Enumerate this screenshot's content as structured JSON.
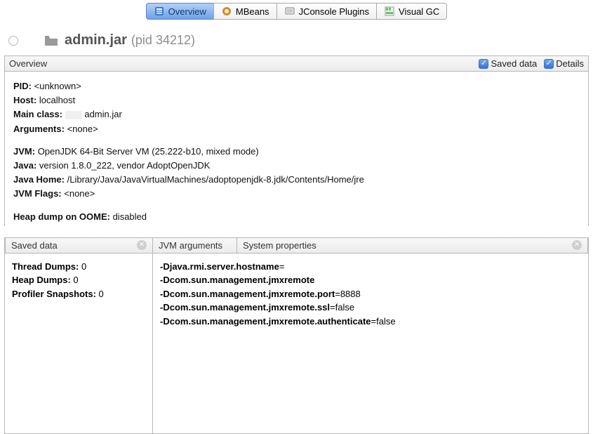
{
  "tabs": [
    {
      "label": "Overview",
      "icon": "overview"
    },
    {
      "label": "MBeans",
      "icon": "mbeans"
    },
    {
      "label": "JConsole Plugins",
      "icon": "jconsole"
    },
    {
      "label": "Visual GC",
      "icon": "visualgc"
    }
  ],
  "header": {
    "title": "admin.jar",
    "pid_label": "(pid 34212)"
  },
  "overview_bar": {
    "title": "Overview",
    "saved_data_label": "Saved data",
    "details_label": "Details"
  },
  "info": {
    "pid_label": "PID:",
    "pid_value": "<unknown>",
    "host_label": "Host:",
    "host_value": "localhost",
    "mainclass_label": "Main class:",
    "mainclass_prefix": "",
    "mainclass_value": "admin.jar",
    "arguments_label": "Arguments:",
    "arguments_value": "<none>",
    "jvm_label": "JVM:",
    "jvm_value": "OpenJDK 64-Bit Server VM (25.222-b10, mixed mode)",
    "java_label": "Java:",
    "java_value": "version 1.8.0_222, vendor AdoptOpenJDK",
    "javahome_label": "Java Home:",
    "javahome_value": "/Library/Java/JavaVirtualMachines/adoptopenjdk-8.jdk/Contents/Home/jre",
    "jvmflags_label": "JVM Flags:",
    "jvmflags_value": "<none>",
    "oome_label": "Heap dump on OOME:",
    "oome_value": "disabled"
  },
  "saved_panel": {
    "title": "Saved data",
    "thread_dumps_label": "Thread Dumps:",
    "thread_dumps_value": "0",
    "heap_dumps_label": "Heap Dumps:",
    "heap_dumps_value": "0",
    "profiler_label": "Profiler Snapshots:",
    "profiler_value": "0"
  },
  "args_panel": {
    "tab1": "JVM arguments",
    "tab2": "System properties",
    "lines": [
      {
        "k": "-Djava.rmi.server.hostname",
        "sep": "=",
        "v": ""
      },
      {
        "k": "-Dcom.sun.management.jmxremote",
        "sep": "",
        "v": ""
      },
      {
        "k": "-Dcom.sun.management.jmxremote.port",
        "sep": "=",
        "v": "8888"
      },
      {
        "k": "-Dcom.sun.management.jmxremote.ssl",
        "sep": "=",
        "v": "false"
      },
      {
        "k": "-Dcom.sun.management.jmxremote.authenticate",
        "sep": "=",
        "v": "false"
      }
    ]
  }
}
